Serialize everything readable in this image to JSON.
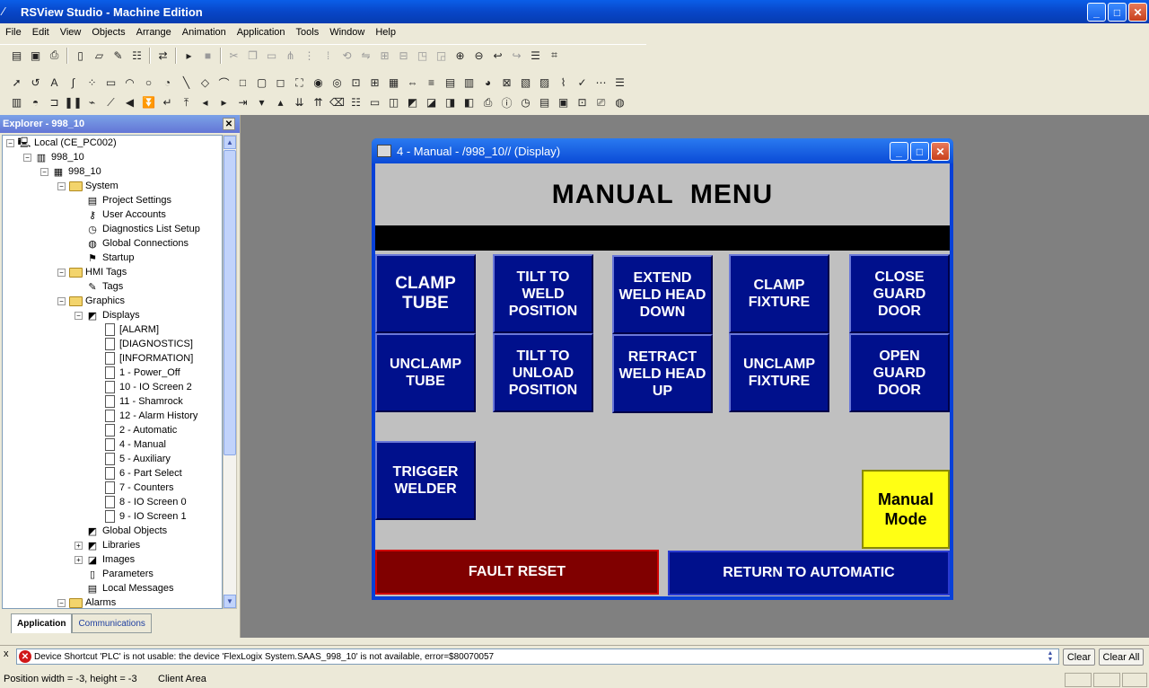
{
  "app": {
    "title": "RSView Studio - Machine Edition",
    "window_controls": {
      "minimize": "_",
      "maximize": "□",
      "close": "✕"
    }
  },
  "menubar": [
    "File",
    "Edit",
    "View",
    "Objects",
    "Arrange",
    "Animation",
    "Application",
    "Tools",
    "Window",
    "Help"
  ],
  "explorer": {
    "title": "Explorer - 998_10",
    "close": "✕",
    "tree": [
      {
        "label": "Local (CE_PC002)",
        "icon": "computer-icon",
        "level": 0,
        "toggle": "−"
      },
      {
        "label": "998_10",
        "icon": "server-icon",
        "level": 1,
        "toggle": "−"
      },
      {
        "label": "998_10",
        "icon": "application-icon",
        "level": 2,
        "toggle": "−"
      },
      {
        "label": "System",
        "icon": "folder-icon",
        "level": 3,
        "toggle": "−"
      },
      {
        "label": "Project Settings",
        "icon": "settings-icon",
        "level": 4
      },
      {
        "label": "User Accounts",
        "icon": "key-icon",
        "level": 4
      },
      {
        "label": "Diagnostics List Setup",
        "icon": "stopwatch-icon",
        "level": 4
      },
      {
        "label": "Global Connections",
        "icon": "globe-icon",
        "level": 4
      },
      {
        "label": "Startup",
        "icon": "flag-icon",
        "level": 4
      },
      {
        "label": "HMI Tags",
        "icon": "folder-icon",
        "level": 3,
        "toggle": "−"
      },
      {
        "label": "Tags",
        "icon": "tag-icon",
        "level": 4
      },
      {
        "label": "Graphics",
        "icon": "folder-icon",
        "level": 3,
        "toggle": "−"
      },
      {
        "label": "Displays",
        "icon": "displays-icon",
        "level": 4,
        "toggle": "−"
      },
      {
        "label": "[ALARM]",
        "icon": "page-icon",
        "level": 5
      },
      {
        "label": "[DIAGNOSTICS]",
        "icon": "page-icon",
        "level": 5
      },
      {
        "label": "[INFORMATION]",
        "icon": "page-icon",
        "level": 5
      },
      {
        "label": "1 - Power_Off",
        "icon": "page-icon",
        "level": 5
      },
      {
        "label": "10 - IO Screen 2",
        "icon": "page-icon",
        "level": 5
      },
      {
        "label": "11 - Shamrock",
        "icon": "page-icon",
        "level": 5
      },
      {
        "label": "12 - Alarm History",
        "icon": "page-icon",
        "level": 5
      },
      {
        "label": "2 - Automatic",
        "icon": "page-icon",
        "level": 5
      },
      {
        "label": "4 - Manual",
        "icon": "page-icon",
        "level": 5
      },
      {
        "label": "5 - Auxiliary",
        "icon": "page-icon",
        "level": 5
      },
      {
        "label": "6 - Part Select",
        "icon": "page-icon",
        "level": 5
      },
      {
        "label": "7 - Counters",
        "icon": "page-icon",
        "level": 5
      },
      {
        "label": "8 - IO Screen 0",
        "icon": "page-icon",
        "level": 5
      },
      {
        "label": "9 - IO Screen 1",
        "icon": "page-icon",
        "level": 5
      },
      {
        "label": "Global Objects",
        "icon": "displays-icon",
        "level": 4
      },
      {
        "label": "Libraries",
        "icon": "displays-icon",
        "level": 4,
        "toggle": "+"
      },
      {
        "label": "Images",
        "icon": "image-icon",
        "level": 4,
        "toggle": "+"
      },
      {
        "label": "Parameters",
        "icon": "parameters-icon",
        "level": 4
      },
      {
        "label": "Local Messages",
        "icon": "messages-icon",
        "level": 4
      },
      {
        "label": "Alarms",
        "icon": "folder-icon",
        "level": 3,
        "toggle": "−"
      }
    ],
    "tabs": [
      {
        "label": "Application",
        "active": true
      },
      {
        "label": "Communications",
        "active": false
      }
    ]
  },
  "display": {
    "window_title": "4 - Manual - /998_10// (Display)",
    "menu_title": "MANUAL  MENU",
    "buttons": [
      {
        "id": "clamp-tube",
        "label": "CLAMP\nTUBE"
      },
      {
        "id": "tilt-weld",
        "label": "TILT TO\nWELD\nPOSITION"
      },
      {
        "id": "extend-weld",
        "label": "EXTEND\nWELD HEAD\nDOWN"
      },
      {
        "id": "clamp-fixture",
        "label": "CLAMP\nFIXTURE"
      },
      {
        "id": "close-guard",
        "label": "CLOSE\nGUARD\nDOOR"
      },
      {
        "id": "unclamp-tube",
        "label": "UNCLAMP\nTUBE"
      },
      {
        "id": "tilt-unload",
        "label": "TILT TO\nUNLOAD\nPOSITION"
      },
      {
        "id": "retract-weld",
        "label": "RETRACT\nWELD HEAD\nUP"
      },
      {
        "id": "unclamp-fixture",
        "label": "UNCLAMP\nFIXTURE"
      },
      {
        "id": "open-guard",
        "label": "OPEN\nGUARD\nDOOR"
      },
      {
        "id": "trigger-welder",
        "label": "TRIGGER\nWELDER"
      }
    ],
    "mode_indicator": "Manual\nMode",
    "fault_reset": "FAULT RESET",
    "return_auto": "RETURN TO AUTOMATIC",
    "colors": {
      "button_blue": "#00108c",
      "fault_red": "#800000",
      "mode_yellow": "#ffff14",
      "canvas_gray": "#c0c0c0"
    }
  },
  "diagnostics": {
    "close": "x",
    "message": "Device Shortcut 'PLC' is not usable: the device 'FlexLogix System.SAAS_998_10' is not available, error=$80070057",
    "clear": "Clear",
    "clear_all": "Clear All"
  },
  "status": {
    "position": "Position width = -3, height = -3",
    "area": "Client Area"
  }
}
